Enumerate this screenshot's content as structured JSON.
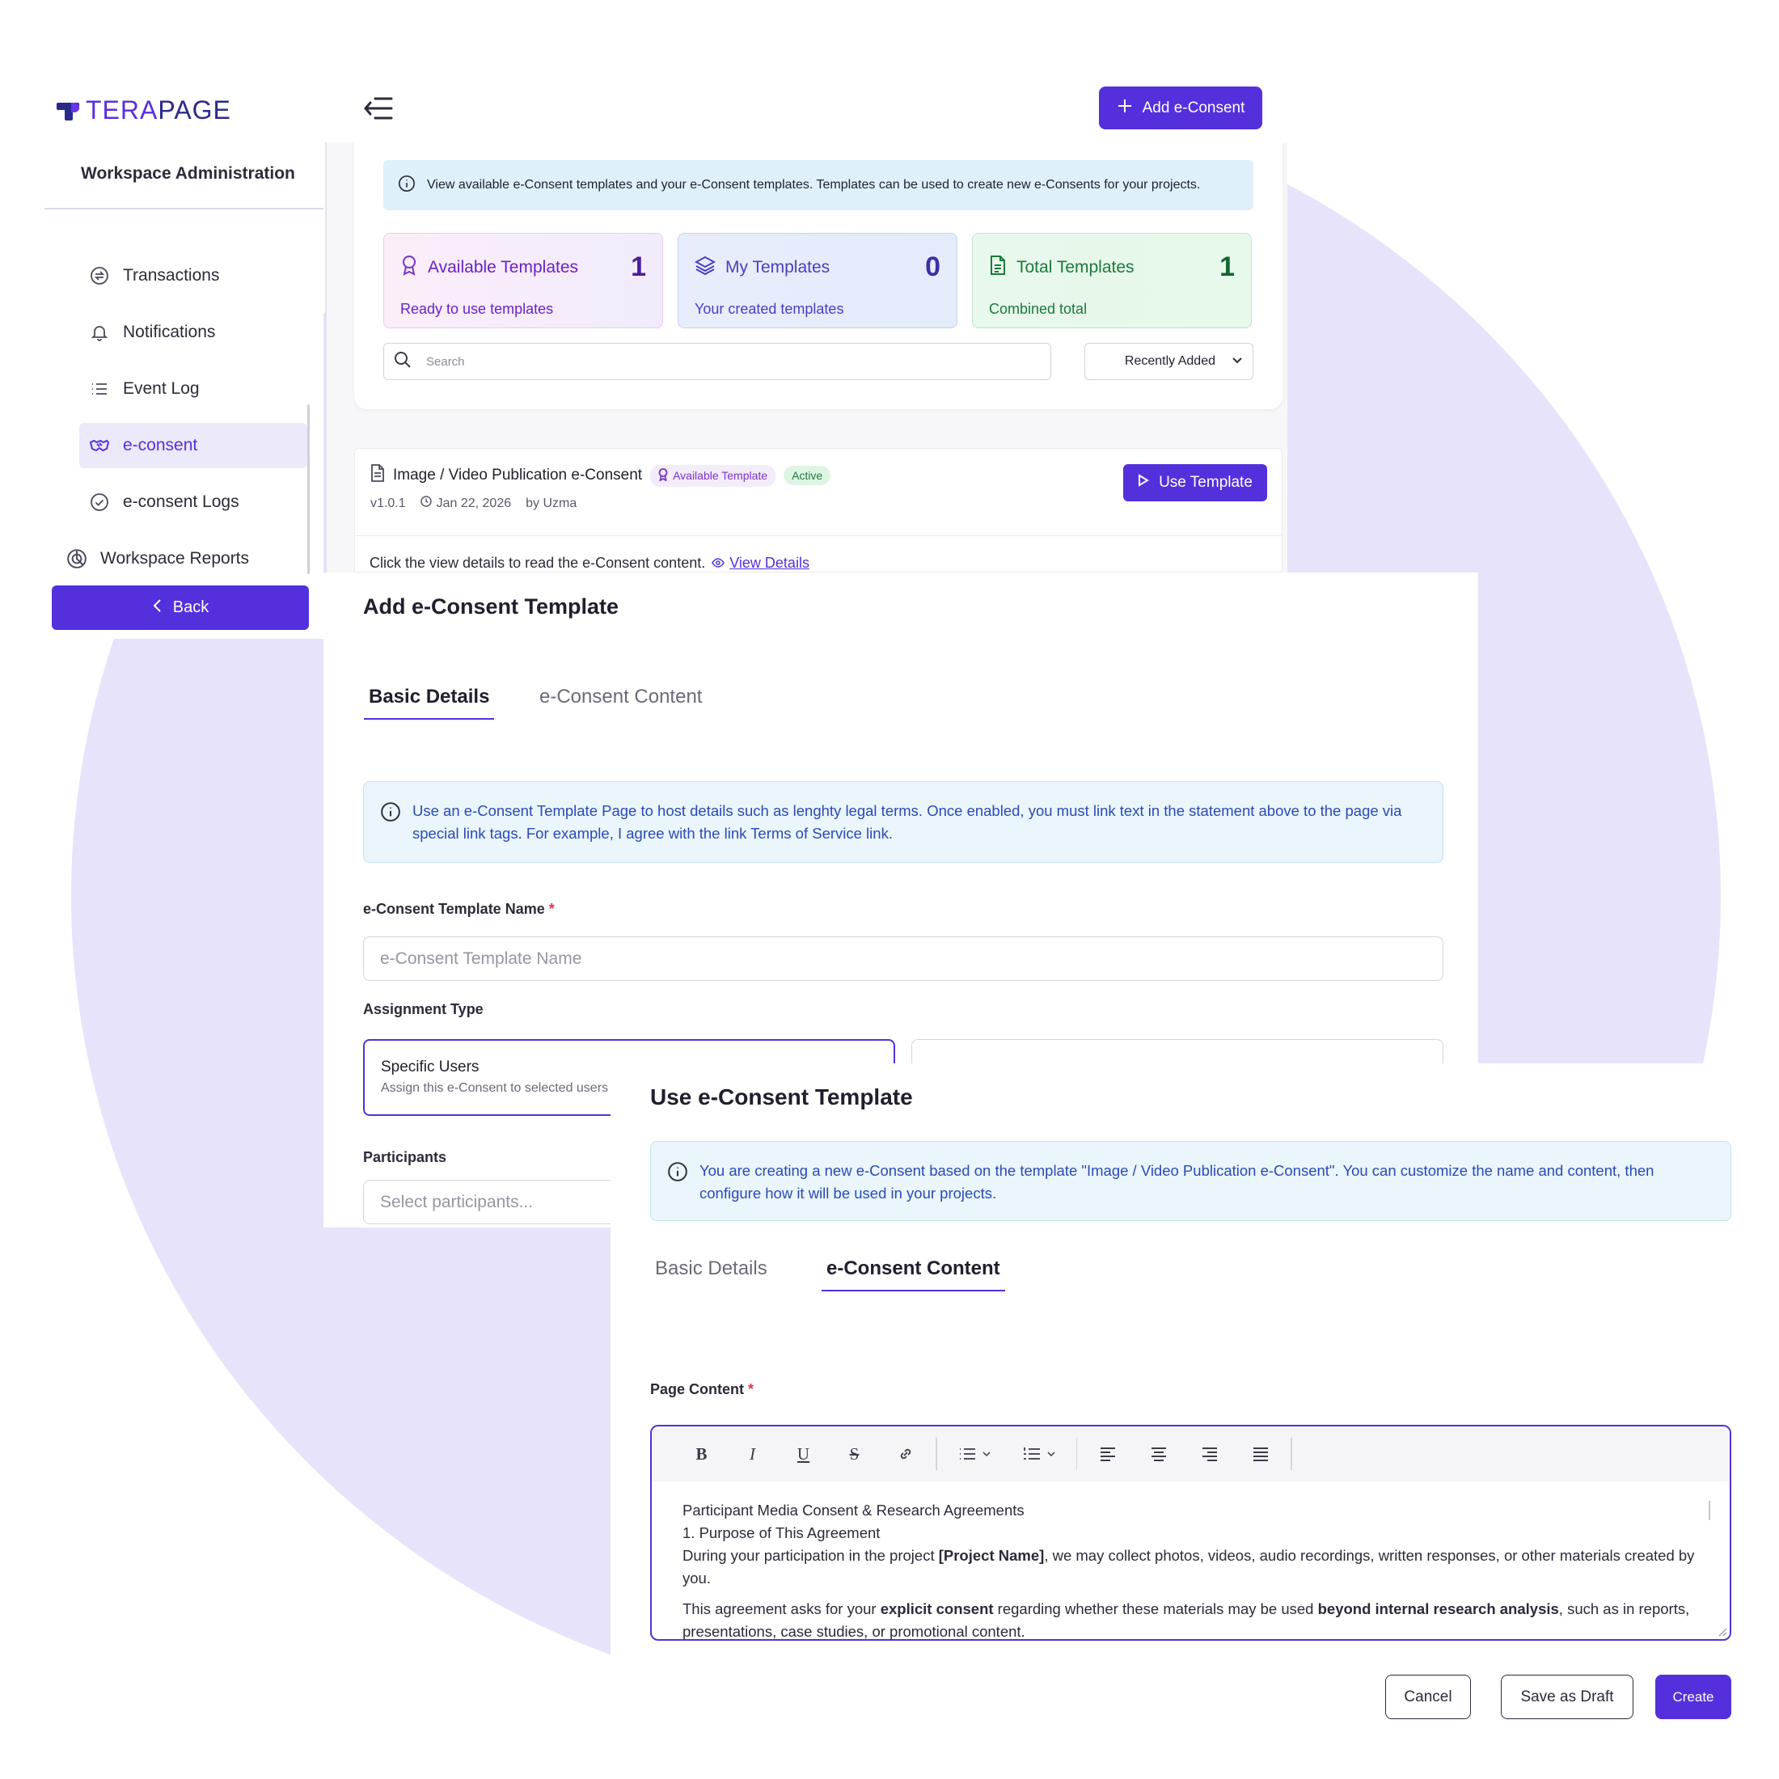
{
  "brand": {
    "logo_text_a": "TERA",
    "logo_text_b": "PAGE",
    "accent": "#5430dd"
  },
  "sidebar": {
    "title": "Workspace Administration",
    "items": [
      {
        "label": "Transactions",
        "icon": "exchange-icon"
      },
      {
        "label": "Notifications",
        "icon": "bell-icon"
      },
      {
        "label": "Event Log",
        "icon": "list-icon"
      },
      {
        "label": "e-consent",
        "icon": "handshake-icon",
        "active": true
      },
      {
        "label": "e-consent Logs",
        "icon": "check-circle-icon"
      },
      {
        "label": "Workspace Reports",
        "icon": "pie-chart-icon"
      }
    ],
    "back_label": "Back"
  },
  "header": {
    "add_label": "Add e-Consent"
  },
  "overview": {
    "info": "View available e-Consent templates and your e-Consent templates. Templates can be used to create new e-Consents for your projects.",
    "stats": [
      {
        "title": "Available Templates",
        "count": "1",
        "sub": "Ready to use templates"
      },
      {
        "title": "My Templates",
        "count": "0",
        "sub": "Your created templates"
      },
      {
        "title": "Total Templates",
        "count": "1",
        "sub": "Combined total"
      }
    ],
    "search_placeholder": "Search",
    "sort_value": "Recently Added"
  },
  "template": {
    "name": "Image / Video Publication e-Consent",
    "badge_available": "Available Template",
    "badge_active": "Active",
    "version": "v1.0.1",
    "date": "Jan 22, 2026",
    "author": "by Uzma",
    "use_label": "Use Template",
    "description": "Click the view details to read the e-Consent content.",
    "view_details": "View Details"
  },
  "add_panel": {
    "title": "Add e-Consent Template",
    "tabs": [
      "Basic Details",
      "e-Consent Content"
    ],
    "info": "Use an e-Consent Template Page to host details such as lenghty legal terms. Once enabled, you must link text in the statement above to the page via special link tags. For example, I agree with the link Terms of Service link.",
    "name_label": "e-Consent Template Name",
    "name_required": "*",
    "name_placeholder": "e-Consent Template Name",
    "assignment_label": "Assignment Type",
    "assign_title": "Specific Users",
    "assign_sub": "Assign this e-Consent to selected users",
    "participants_label": "Participants",
    "participants_placeholder": "Select participants..."
  },
  "use_panel": {
    "title": "Use e-Consent Template",
    "info": "You are creating a new e-Consent based on the template \"Image / Video Publication e-Consent\". You can customize the name and content, then configure how it will be used in your projects.",
    "tabs": [
      "Basic Details",
      "e-Consent Content"
    ],
    "content_label": "Page Content",
    "content_required": "*",
    "content": {
      "heading": "Participant Media Consent & Research Agreements",
      "section1": "1. Purpose of This Agreement",
      "p1_a": "During your participation in the project ",
      "p1_b": "[Project Name]",
      "p1_c": ", we may collect photos, videos, audio recordings, written responses, or other materials created by you.",
      "p2_a": "This agreement asks for your ",
      "p2_b": "explicit consent",
      "p2_c": " regarding whether these materials may be used ",
      "p2_d": "beyond internal research analysis",
      "p2_e": ", such as in reports, presentations, case studies, or promotional content."
    },
    "cancel_label": "Cancel",
    "draft_label": "Save as Draft",
    "create_label": "Create"
  }
}
